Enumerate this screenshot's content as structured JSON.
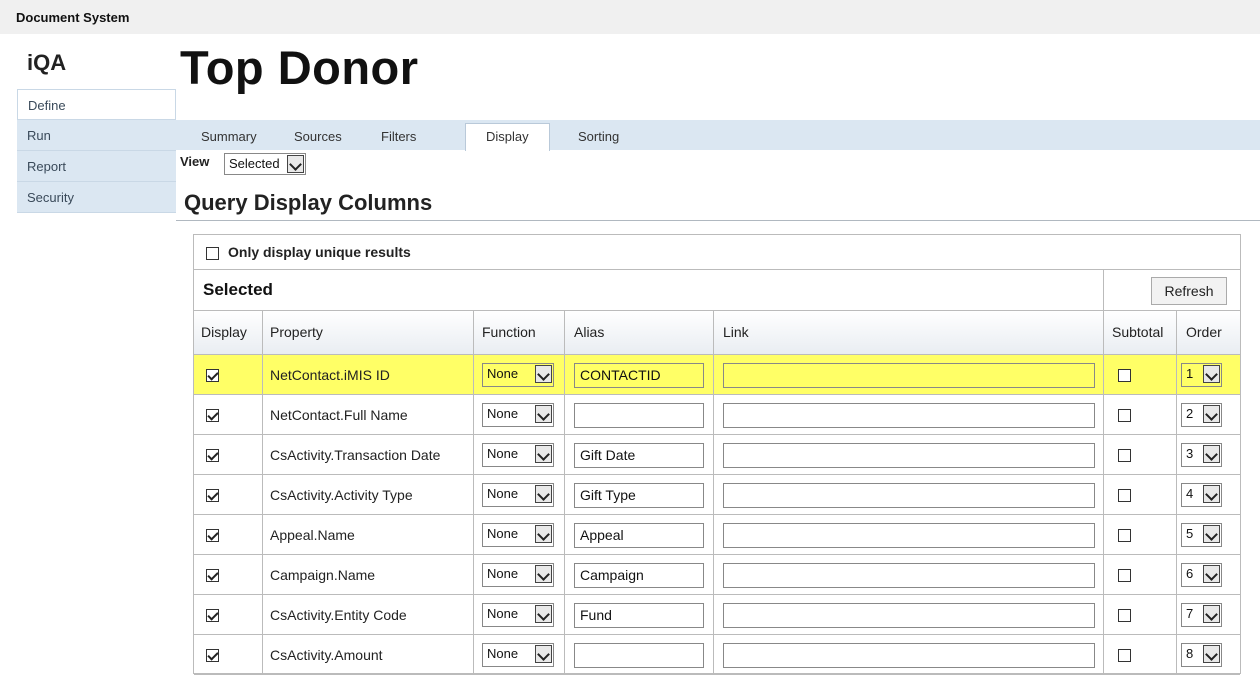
{
  "window": {
    "title": "Document System"
  },
  "app": {
    "name": "iQA"
  },
  "nav": {
    "items": [
      "Define",
      "Run",
      "Report",
      "Security"
    ],
    "active": "Define"
  },
  "page": {
    "title": "Top Donor"
  },
  "tabs": {
    "items": [
      "Summary",
      "Sources",
      "Filters",
      "Display",
      "Sorting"
    ],
    "active": "Display"
  },
  "view": {
    "label": "View",
    "value": "Selected"
  },
  "section": {
    "title": "Query Display Columns"
  },
  "panel": {
    "unique_label": "Only display unique results",
    "unique_checked": false,
    "selected_label": "Selected",
    "refresh_label": "Refresh"
  },
  "grid": {
    "headers": [
      "Display",
      "Property",
      "Function",
      "Alias",
      "Link",
      "Subtotal",
      "Order"
    ],
    "rows": [
      {
        "display": true,
        "property": "NetContact.iMIS ID",
        "function": "None",
        "alias": "CONTACTID",
        "link": "",
        "subtotal": false,
        "order": "1",
        "highlight": true
      },
      {
        "display": true,
        "property": "NetContact.Full Name",
        "function": "None",
        "alias": "",
        "link": "",
        "subtotal": false,
        "order": "2",
        "highlight": false
      },
      {
        "display": true,
        "property": "CsActivity.Transaction Date",
        "function": "None",
        "alias": "Gift Date",
        "link": "",
        "subtotal": false,
        "order": "3",
        "highlight": false
      },
      {
        "display": true,
        "property": "CsActivity.Activity Type",
        "function": "None",
        "alias": "Gift Type",
        "link": "",
        "subtotal": false,
        "order": "4",
        "highlight": false
      },
      {
        "display": true,
        "property": "Appeal.Name",
        "function": "None",
        "alias": "Appeal",
        "link": "",
        "subtotal": false,
        "order": "5",
        "highlight": false
      },
      {
        "display": true,
        "property": "Campaign.Name",
        "function": "None",
        "alias": "Campaign",
        "link": "",
        "subtotal": false,
        "order": "6",
        "highlight": false
      },
      {
        "display": true,
        "property": "CsActivity.Entity Code",
        "function": "None",
        "alias": "Fund",
        "link": "",
        "subtotal": false,
        "order": "7",
        "highlight": false
      },
      {
        "display": true,
        "property": "CsActivity.Amount",
        "function": "None",
        "alias": "",
        "link": "",
        "subtotal": false,
        "order": "8",
        "highlight": false
      }
    ]
  },
  "colors": {
    "highlight": "#ffff66",
    "nav_bg": "#dbe7f2",
    "tab_bg": "#dbe7f2"
  }
}
